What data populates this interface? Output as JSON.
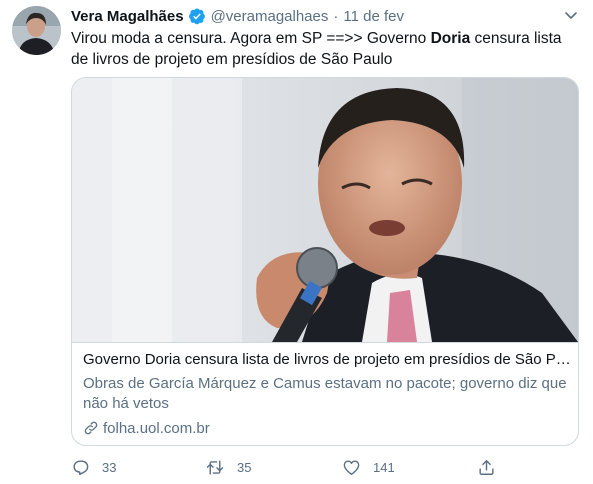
{
  "author": {
    "display_name": "Vera Magalhães",
    "handle": "@veramagalhaes",
    "separator": "·",
    "time": "11 de fev",
    "verified": true
  },
  "tweet": {
    "text_before": "Virou moda a censura. Agora em SP ==>> Governo ",
    "text_bold": "Doria",
    "text_after": " censura lista de livros de projeto em presídios de São Paulo"
  },
  "card": {
    "title": "Governo Doria censura lista de livros de projeto em presídios de São Paulo",
    "description": "Obras de García Márquez e Camus estavam no pacote; governo diz que não há vetos",
    "domain": "folha.uol.com.br",
    "domain_icon": "link-icon"
  },
  "actions": {
    "replies": "33",
    "retweets": "35",
    "likes": "141"
  },
  "colors": {
    "text": "#0f1419",
    "secondary": "#5b7083",
    "border": "#cfd9de",
    "verified": "#1da1f2"
  }
}
